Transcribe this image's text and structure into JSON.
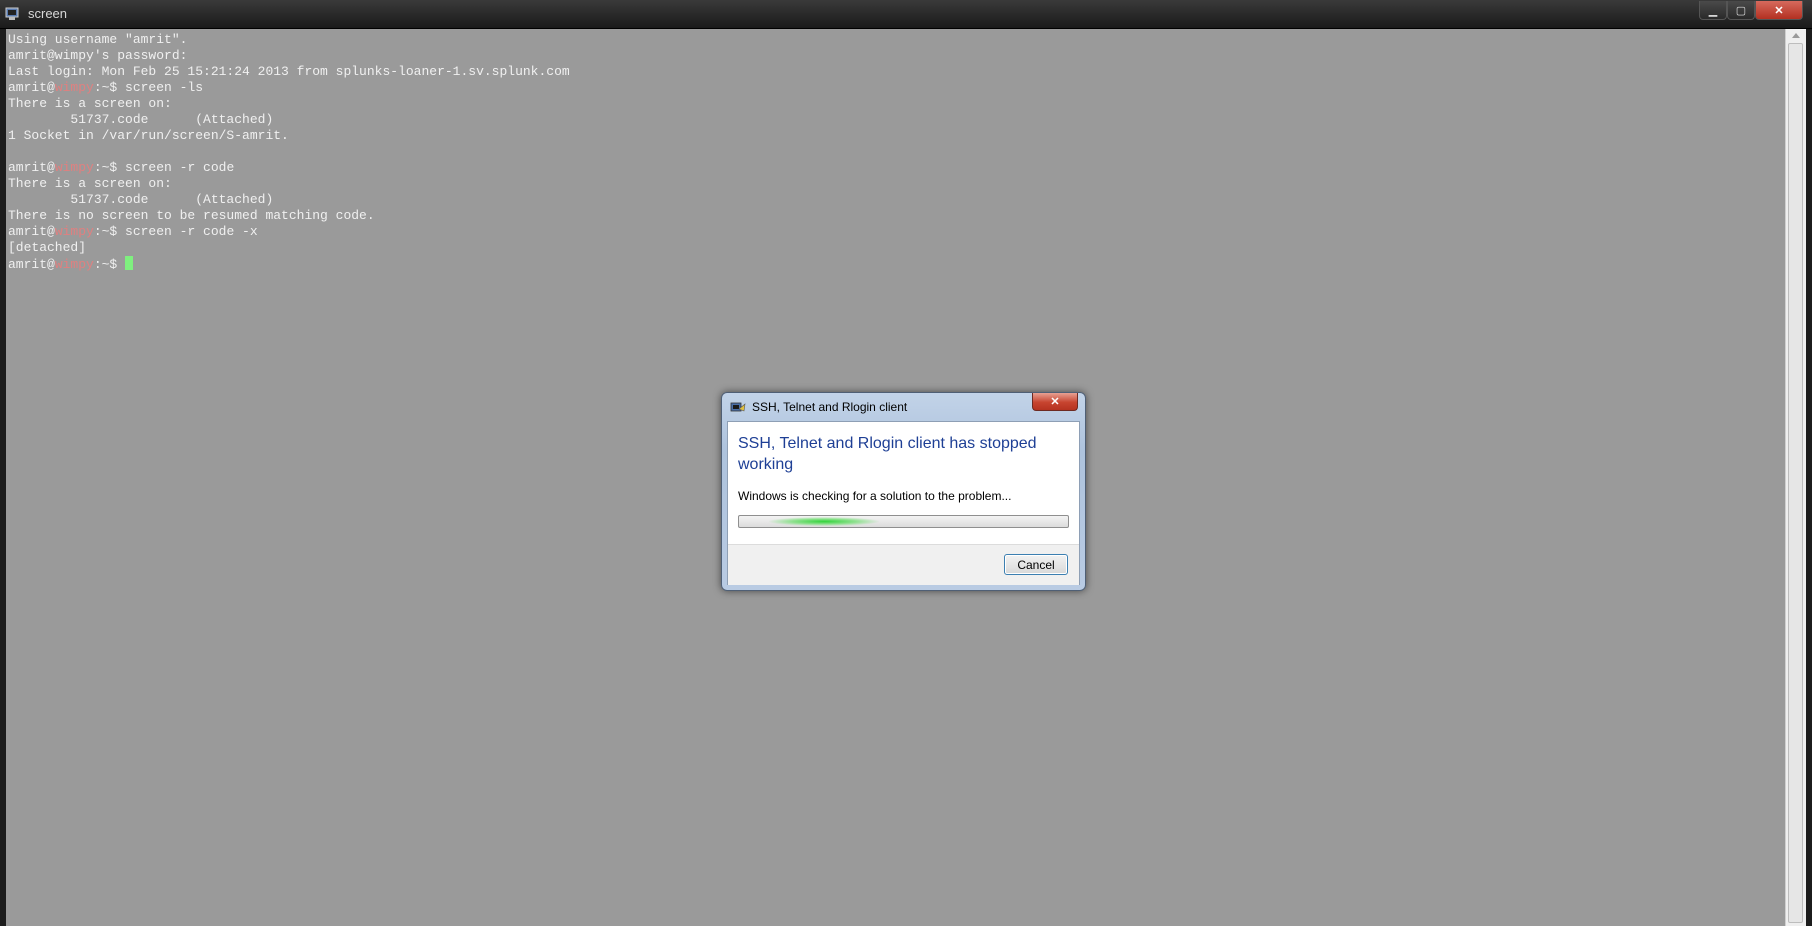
{
  "window": {
    "title": "screen",
    "minimize_glyph": "▁",
    "maximize_glyph": "▢",
    "close_glyph": "✕"
  },
  "terminal": {
    "lines": [
      "Using username \"amrit\".",
      "amrit@wimpy's password:",
      "Last login: Mon Feb 25 15:21:24 2013 from splunks-loaner-1.sv.splunk.com",
      {
        "user": "amrit@",
        "host": "wimpy",
        "suffix": ":~$ screen -ls"
      },
      "There is a screen on:",
      "        51737.code      (Attached)",
      "1 Socket in /var/run/screen/S-amrit.",
      "",
      {
        "user": "amrit@",
        "host": "wimpy",
        "suffix": ":~$ screen -r code"
      },
      "There is a screen on:",
      "        51737.code      (Attached)",
      "There is no screen to be resumed matching code.",
      {
        "user": "amrit@",
        "host": "wimpy",
        "suffix": ":~$ screen -r code -x"
      },
      "[detached]",
      {
        "user": "amrit@",
        "host": "wimpy",
        "suffix": ":~$ ",
        "cursor": true
      }
    ],
    "colors": {
      "background": "#9a9a9a",
      "text": "#f0f0f0",
      "host": "#e08080",
      "cursor": "#7ff07f"
    }
  },
  "dialog": {
    "title": "SSH, Telnet and Rlogin client",
    "heading": "SSH, Telnet and Rlogin client has stopped working",
    "message": "Windows is checking for a solution to the problem...",
    "cancel_label": "Cancel",
    "close_glyph": "✕",
    "progress_state": "indeterminate",
    "heading_color": "#1e3f95"
  }
}
